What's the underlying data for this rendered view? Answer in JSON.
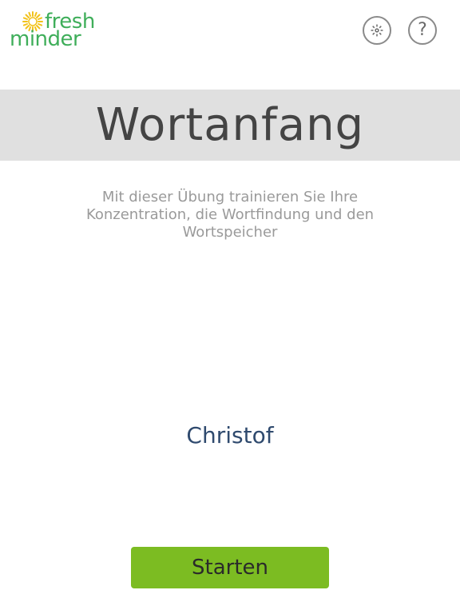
{
  "logo": {
    "line1": "fresh",
    "line2": "minder",
    "sun_icon": "sun-icon",
    "color": "#3fae5a",
    "sun_color": "#f2c21a"
  },
  "header": {
    "settings_icon": "gear-icon",
    "help_label": "?"
  },
  "title": "Wortanfang",
  "description": "Mit dieser Übung trainieren Sie Ihre Konzentration, die Wortfindung und den Wortspeicher",
  "user": {
    "name": "Christof"
  },
  "actions": {
    "start_label": "Starten",
    "start_color": "#7cbc22"
  }
}
